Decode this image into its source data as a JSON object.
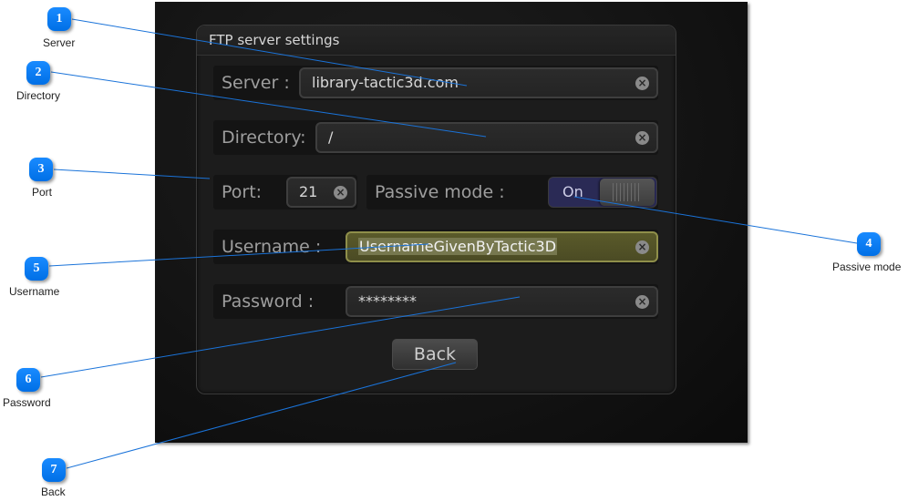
{
  "app": {
    "panel_title": "FTP server settings",
    "fields": {
      "server": {
        "label": "Server :",
        "value": "library-tactic3d.com"
      },
      "directory": {
        "label": "Directory:",
        "value": "/"
      },
      "port": {
        "label": "Port:",
        "value": "21"
      },
      "passive_mode": {
        "label": "Passive mode :",
        "state": "On"
      },
      "username": {
        "label": "Username :",
        "value": "UsernameGivenByTactic3D"
      },
      "password": {
        "label": "Password :",
        "value": "********"
      }
    },
    "clear_icon": "×",
    "back_label": "Back"
  },
  "callouts": [
    {
      "number": "1",
      "caption": "Server"
    },
    {
      "number": "2",
      "caption": "Directory"
    },
    {
      "number": "3",
      "caption": "Port"
    },
    {
      "number": "4",
      "caption": "Passive mode"
    },
    {
      "number": "5",
      "caption": "Username"
    },
    {
      "number": "6",
      "caption": "Password"
    },
    {
      "number": "7",
      "caption": "Back"
    }
  ],
  "colors": {
    "callout_blue": "#0a7df5",
    "leader_line": "#1a73d9",
    "toggle_on": "#2a2a55",
    "active_field": "#5a5a2a"
  }
}
